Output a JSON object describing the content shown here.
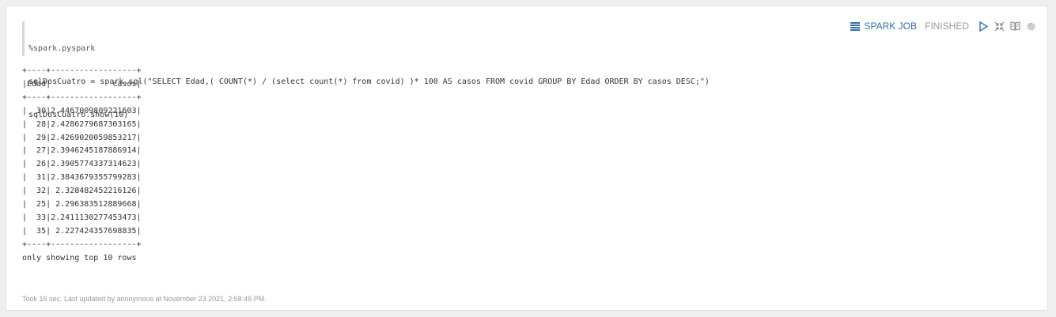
{
  "editor": {
    "lines": [
      "%spark.pyspark",
      "sqlDosCuatro = spark.sql(\"SELECT Edad,( COUNT(*) / (select count(*) from covid) )* 100 AS casos FROM covid GROUP BY Edad ORDER BY casos DESC;\")",
      "sqlDosCuatro.show(10)"
    ]
  },
  "toolbar": {
    "job_label": "SPARK JOB",
    "status": "FINISHED",
    "icons": [
      "spark-job-icon",
      "run-icon",
      "collapse-icon",
      "book-icon",
      "gear-icon"
    ],
    "colors": {
      "link": "#3071a9",
      "status": "#999999",
      "icon": "#8a8a8a"
    }
  },
  "output": {
    "lines": [
      "+----+------------------+",
      "|Edad|             casos|",
      "+----+------------------+",
      "|  30|2.4467009809221603|",
      "|  28|2.4286279687303165|",
      "|  29|2.4269020059853217|",
      "|  27|2.3946245187886914|",
      "|  26|2.3905774337314623|",
      "|  31|2.3843679355799283|",
      "|  32| 2.328482452216126|",
      "|  25| 2.296383512889668|",
      "|  33|2.2411130277453473|",
      "|  35| 2.227424357698835|",
      "+----+------------------+",
      "only showing top 10 rows"
    ]
  },
  "footer": {
    "text": "Took 16 sec. Last updated by anonymous at November 23 2021, 2:58:46 PM."
  }
}
